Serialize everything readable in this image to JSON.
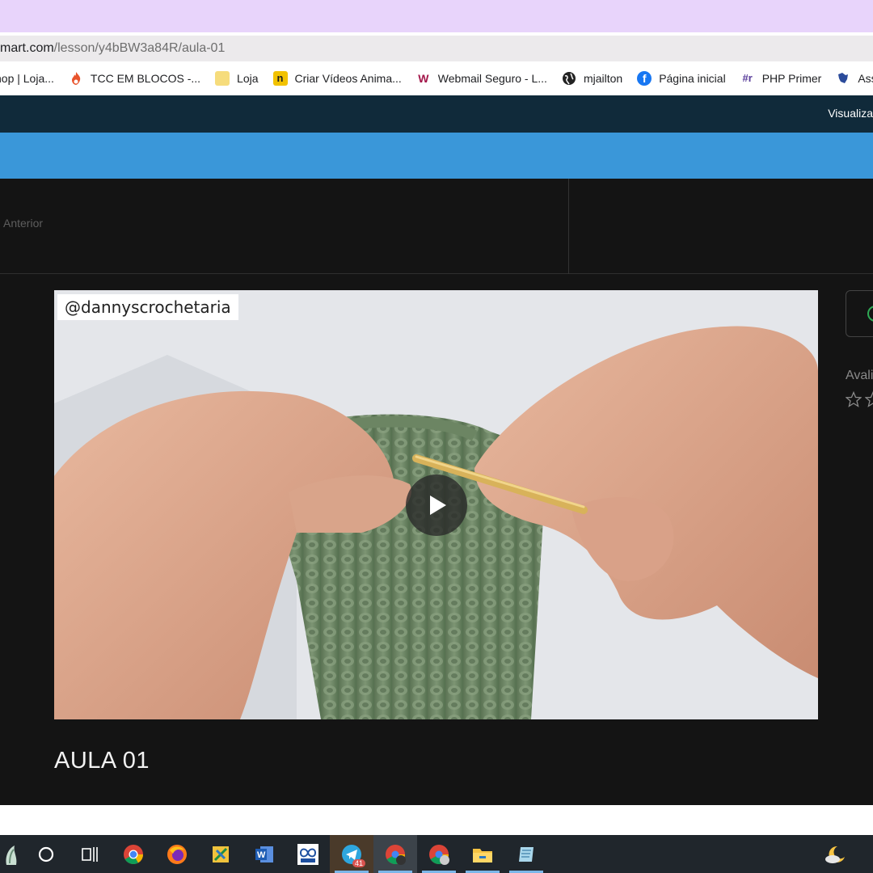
{
  "browser": {
    "url_host": "mart.com",
    "url_path": "/lesson/y4bBW3a84R/aula-01"
  },
  "bookmarks": [
    {
      "label": "hop | Loja...",
      "icon": "shop-icon",
      "color": "#555555"
    },
    {
      "label": "TCC EM BLOCOS -...",
      "icon": "flame-icon",
      "color": "#e8542c"
    },
    {
      "label": "Loja",
      "icon": "folder-icon",
      "color": "#f4d35e"
    },
    {
      "label": "Criar Vídeos Anima...",
      "icon": "n-logo-icon",
      "color": "#f2c200"
    },
    {
      "label": "Webmail Seguro - L...",
      "icon": "w-logo-icon",
      "color": "#a3174a"
    },
    {
      "label": "mjailton",
      "icon": "globe-icon",
      "color": "#222222"
    },
    {
      "label": "Página inicial",
      "icon": "facebook-icon",
      "color": "#1877f2"
    },
    {
      "label": "PHP Primer",
      "icon": "php-icon",
      "color": "#5a3e9b"
    },
    {
      "label": "Assess",
      "icon": "map-icon",
      "color": "#2b4b9b"
    }
  ],
  "header": {
    "visualize_label": "Visualiza"
  },
  "lesson_nav": {
    "previous_label": "Anterior"
  },
  "video": {
    "watermark": "@dannyscrochetaria"
  },
  "lesson": {
    "title": "AULA 01"
  },
  "sidebar": {
    "rating_label": "Avali"
  },
  "taskbar": {
    "apps": [
      "start-icon",
      "search-circle-icon",
      "task-view-icon",
      "chrome-icon",
      "firefox-icon",
      "sheets-icon",
      "word-icon",
      "maker-icon",
      "telegram-icon",
      "chrome-profile-icon",
      "chrome-profile2-icon",
      "file-explorer-icon",
      "notepad-icon"
    ],
    "telegram_badge": "41"
  }
}
